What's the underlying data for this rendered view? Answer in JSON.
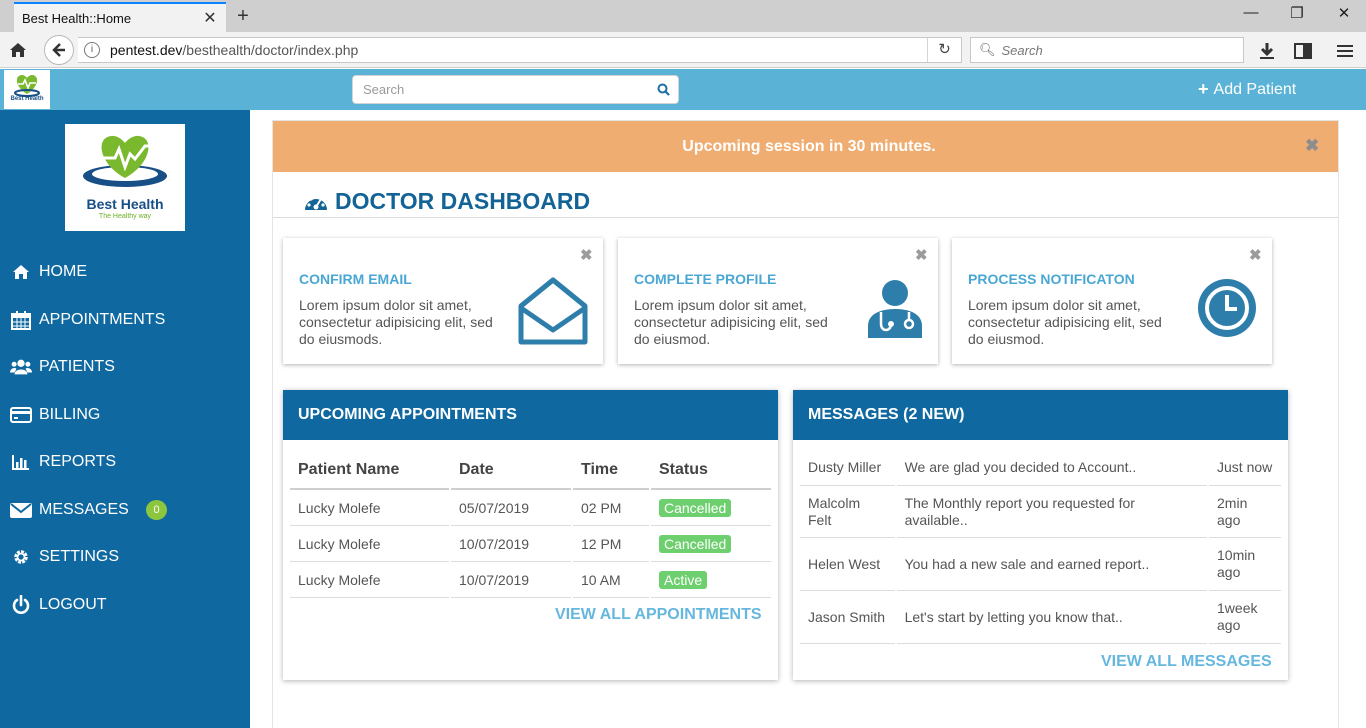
{
  "browser": {
    "tab_title": "Best Health::Home",
    "url_host": "pentest.dev",
    "url_path": "/besthealth/doctor/index.php",
    "search_placeholder": "Search"
  },
  "header": {
    "search_placeholder": "Search",
    "add_patient_label": "Add Patient"
  },
  "brand": {
    "name": "Best Health",
    "tagline": "The Healthy way",
    "mini_name": "Best Health"
  },
  "sidebar": {
    "items": [
      {
        "label": "HOME",
        "icon": "home-icon"
      },
      {
        "label": "APPOINTMENTS",
        "icon": "calendar-icon"
      },
      {
        "label": "PATIENTS",
        "icon": "users-icon"
      },
      {
        "label": "BILLING",
        "icon": "credit-card-icon"
      },
      {
        "label": "REPORTS",
        "icon": "bar-chart-icon"
      },
      {
        "label": "MESSAGES",
        "icon": "envelope-icon",
        "badge": "0"
      },
      {
        "label": "SETTINGS",
        "icon": "gear-icon"
      },
      {
        "label": "LOGOUT",
        "icon": "power-icon"
      }
    ]
  },
  "alert": {
    "text": "Upcoming session in 30 minutes."
  },
  "dashboard": {
    "title": "DOCTOR DASHBOARD"
  },
  "cards": [
    {
      "title": "CONFIRM EMAIL",
      "text": "Lorem ipsum dolor sit amet, consectetur adipisicing elit, sed do eiusmods.",
      "icon": "open-envelope-icon"
    },
    {
      "title": "COMPLETE PROFILE",
      "text": "Lorem ipsum dolor sit amet, consectetur adipisicing elit, sed do eiusmod.",
      "icon": "doctor-icon"
    },
    {
      "title": "PROCESS NOTIFICATON",
      "text": "Lorem ipsum dolor sit amet, consectetur adipisicing elit, sed do eiusmod.",
      "icon": "clock-icon"
    }
  ],
  "appointments": {
    "title": "UPCOMING APPOINTMENTS",
    "columns": [
      "Patient Name",
      "Date",
      "Time",
      "Status"
    ],
    "rows": [
      {
        "name": "Lucky Molefe",
        "date": "05/07/2019",
        "time": "02 PM",
        "status": "Cancelled"
      },
      {
        "name": "Lucky Molefe",
        "date": "10/07/2019",
        "time": "12 PM",
        "status": "Cancelled"
      },
      {
        "name": "Lucky Molefe",
        "date": "10/07/2019",
        "time": "10 AM",
        "status": "Active"
      }
    ],
    "view_all": "VIEW ALL APPOINTMENTS"
  },
  "messages": {
    "title": "MESSAGES (2 NEW)",
    "rows": [
      {
        "sender": "Dusty Miller",
        "text": "We are glad you decided to Account..",
        "time": "Just now"
      },
      {
        "sender": "Malcolm Felt",
        "text": "The Monthly report you requested for available..",
        "time": "2min ago"
      },
      {
        "sender": "Helen West",
        "text": "You had a new sale and earned report..",
        "time": "10min ago"
      },
      {
        "sender": "Jason Smith",
        "text": "Let's start by letting you know that..",
        "time": "1week ago"
      }
    ],
    "view_all": "VIEW ALL MESSAGES"
  },
  "colors": {
    "header": "#5ab3d6",
    "sidebar": "#0f69a0",
    "alert": "#f0ad72",
    "accent": "#4aa7d4",
    "badge_green": "#6ecf6e"
  }
}
